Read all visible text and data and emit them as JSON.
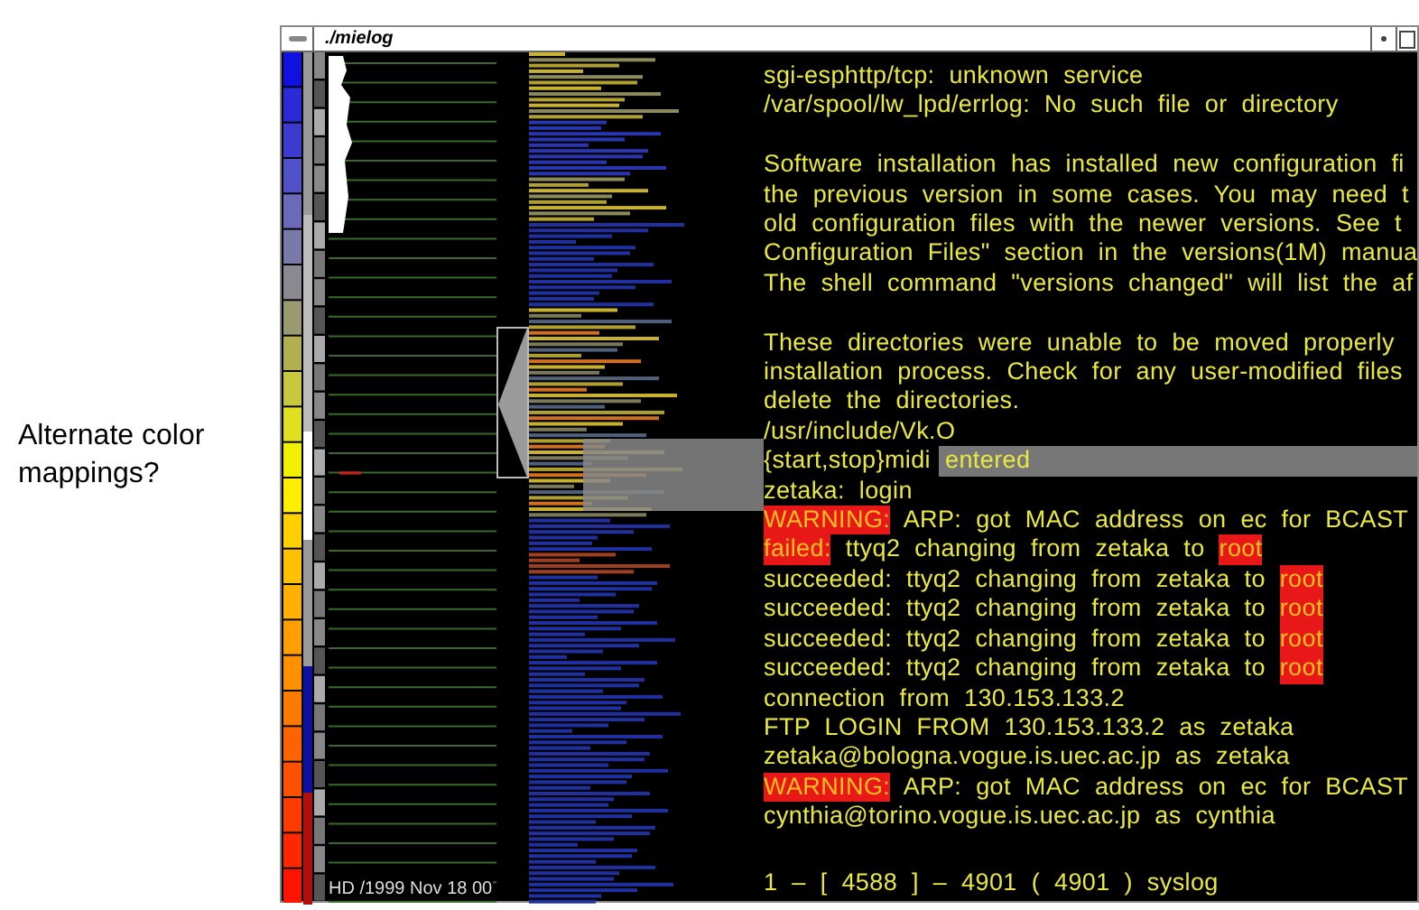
{
  "caption": "Alternate color mappings?",
  "window": {
    "title": "./mielog"
  },
  "overview": {
    "label": "HD /1999 Nov 18 00"
  },
  "log": {
    "paragraphs": [
      [
        [
          {
            "text": "sgi-esphttp/tcp: unknown service",
            "kind": "normal"
          }
        ],
        [
          {
            "text": "/var/spool/lw_lpd/errlog: No such file or directory",
            "kind": "normal"
          }
        ]
      ],
      [
        [
          {
            "text": "Software installation has installed new configuration fi",
            "kind": "normal"
          }
        ],
        [
          {
            "text": "the previous version in some cases. You may need t",
            "kind": "normal"
          }
        ],
        [
          {
            "text": "old configuration files with the newer versions. See t",
            "kind": "normal"
          }
        ],
        [
          {
            "text": "Configuration Files\" section in the versions(1M) manua",
            "kind": "normal"
          }
        ],
        [
          {
            "text": "The shell command \"versions changed\" will list the af",
            "kind": "normal"
          }
        ]
      ],
      [
        [
          {
            "text": "These directories were unable to be moved properly",
            "kind": "normal"
          }
        ],
        [
          {
            "text": "installation process. Check for any user-modified files",
            "kind": "normal"
          }
        ],
        [
          {
            "text": "delete the directories.",
            "kind": "normal"
          }
        ],
        [
          {
            "text": "/usr/include/Vk.O",
            "kind": "normal"
          }
        ],
        [
          {
            "text": "{start,stop}midi",
            "kind": "normal"
          },
          {
            "text": "entered",
            "kind": "highlighted"
          }
        ],
        [
          {
            "text": "zetaka: login",
            "kind": "normal"
          }
        ],
        [
          {
            "text": "WARNING:",
            "kind": "alert"
          },
          {
            "text": " ARP: got MAC address on ec for BCAST",
            "kind": "normal"
          }
        ],
        [
          {
            "text": "failed:",
            "kind": "alert"
          },
          {
            "text": " ttyq2 changing from zetaka to ",
            "kind": "normal"
          },
          {
            "text": "root",
            "kind": "alert"
          }
        ],
        [
          {
            "text": "succeeded: ttyq2 changing from zetaka to ",
            "kind": "normal"
          },
          {
            "text": "root",
            "kind": "alert"
          }
        ],
        [
          {
            "text": "succeeded: ttyq2 changing from zetaka to ",
            "kind": "normal"
          },
          {
            "text": "root",
            "kind": "alert"
          }
        ],
        [
          {
            "text": "succeeded: ttyq2 changing from zetaka to ",
            "kind": "normal"
          },
          {
            "text": "root",
            "kind": "alert"
          }
        ],
        [
          {
            "text": "succeeded: ttyq2 changing from zetaka to ",
            "kind": "normal"
          },
          {
            "text": "root",
            "kind": "alert"
          }
        ],
        [
          {
            "text": "connection from 130.153.133.2",
            "kind": "normal"
          }
        ],
        [
          {
            "text": "FTP LOGIN FROM 130.153.133.2 as zetaka",
            "kind": "normal"
          }
        ],
        [
          {
            "text": "zetaka@bologna.vogue.is.uec.ac.jp as zetaka",
            "kind": "normal"
          }
        ],
        [
          {
            "text": "WARNING:",
            "kind": "alert"
          },
          {
            "text": " ARP: got MAC address on ec for BCAST",
            "kind": "normal"
          }
        ],
        [
          {
            "text": "cynthia@torino.vogue.is.uec.ac.jp as cynthia",
            "kind": "normal"
          }
        ]
      ]
    ],
    "status": "1 – [ 4588 ] – 4901 ( 4901 ) syslog"
  }
}
